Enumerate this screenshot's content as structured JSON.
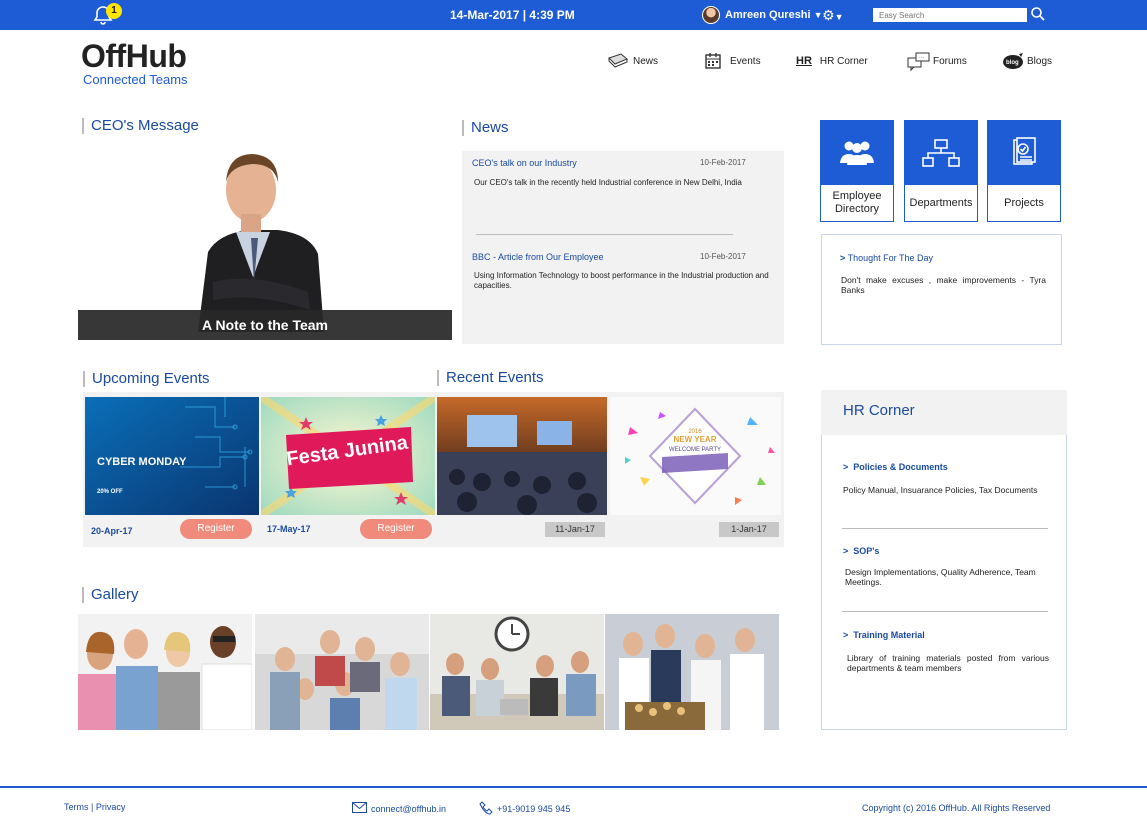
{
  "topbar": {
    "notif_count": "1",
    "datetime": "14-Mar-2017 | 4:39 PM",
    "username": "Amreen Qureshi",
    "user_caret": "▼",
    "gear_caret": "▼",
    "search_placeholder": "Easy Search"
  },
  "logo": {
    "main": "OffHub",
    "sub": "Connected Teams"
  },
  "nav": [
    {
      "label": "News"
    },
    {
      "label": "Events"
    },
    {
      "label": "HR Corner",
      "prefix": "HR"
    },
    {
      "label": "Forums"
    },
    {
      "label": "Blogs"
    }
  ],
  "ceo": {
    "heading": "CEO's Message",
    "caption": "A Note to the Team"
  },
  "news": {
    "heading": "News",
    "items": [
      {
        "title": "CEO's talk on our Industry",
        "date": "10-Feb-2017",
        "body": "Our CEO's talk in the recently held Industrial conference in New Delhi, India"
      },
      {
        "title": "BBC  - Article from Our Employee",
        "date": "10-Feb-2017",
        "body": "Using Information Technology to boost performance in the Industrial production and capacities."
      }
    ]
  },
  "tiles": [
    {
      "label": "Employee Directory"
    },
    {
      "label": "Departments"
    },
    {
      "label": "Projects"
    }
  ],
  "thought": {
    "title": "Thought For The Day",
    "body": "Don't make excuses , make improvements - Tyra Banks"
  },
  "upcoming": {
    "heading": "Upcoming Events",
    "items": [
      {
        "date": "20-Apr-17",
        "button": "Register",
        "img_title": "CYBER MONDAY",
        "img_sub": "20% OFF"
      },
      {
        "date": "17-May-17",
        "button": "Register",
        "img_title": "Festa Junina"
      }
    ]
  },
  "recent": {
    "heading": "Recent Events",
    "items": [
      {
        "date": "11-Jan-17"
      },
      {
        "date": "1-Jan-17",
        "img_year": "2016",
        "img_title": "NEW YEAR",
        "img_sub": "WELCOME PARTY"
      }
    ]
  },
  "gallery": {
    "heading": "Gallery"
  },
  "hr": {
    "heading": "HR Corner",
    "items": [
      {
        "title": "Policies & Documents",
        "body": "Policy Manual, Insuarance Policies, Tax Documents"
      },
      {
        "title": "SOP's",
        "body": "Design Implementations, Quality Adherence, Team Meetings."
      },
      {
        "title": "Training Material",
        "body": "Library of training materials posted from various departments & team members"
      }
    ]
  },
  "footer": {
    "terms": "Terms",
    "sep": " | ",
    "privacy": "Privacy",
    "email": "connect@offhub.in",
    "phone": "+91-9019 945 945",
    "copyright": "Copyright (c) 2016 OffHub. All Rights Reserved"
  },
  "colors": {
    "brand": "#1e5cd6",
    "register": "#f08a7a",
    "badge": "#ffe600"
  }
}
